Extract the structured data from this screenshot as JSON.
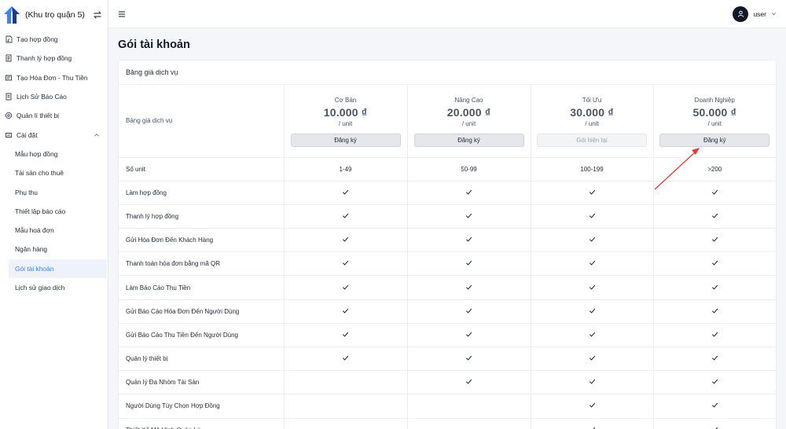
{
  "brand": {
    "name": "(Khu trọ quận 5)"
  },
  "sidebar": {
    "items": [
      {
        "label": "Tạo hợp đồng",
        "icon": "contract-icon"
      },
      {
        "label": "Thanh lý hợp đồng",
        "icon": "document-icon"
      },
      {
        "label": "Tạo Hóa Đơn - Thu Tiền",
        "icon": "invoice-icon"
      },
      {
        "label": "Lịch Sử Báo Cáo",
        "icon": "report-icon"
      },
      {
        "label": "Quản lí thiết bị",
        "icon": "device-icon"
      },
      {
        "label": "Cài đặt",
        "icon": "settings-icon"
      }
    ],
    "sub_items": [
      "Mẫu hợp đồng",
      "Tài sản cho thuê",
      "Phụ thu",
      "Thiết lập báo cáo",
      "Mẫu hoá đơn",
      "Ngân hàng",
      "Gói tài khoản",
      "Lịch sử giao dịch"
    ],
    "active": "Gói tài khoản"
  },
  "topbar": {
    "user_name": "user"
  },
  "page": {
    "title": "Gói tài khoản",
    "card_title": "Bảng giá dịch vụ",
    "header_label": "Bảng giá dịch vụ"
  },
  "plans": [
    {
      "name": "Cơ Bản",
      "price": "10.000 ₫",
      "unit": "/ unit",
      "button": "Đăng ký",
      "current": false
    },
    {
      "name": "Nâng Cao",
      "price": "20.000 ₫",
      "unit": "/ unit",
      "button": "Đăng ký",
      "current": false
    },
    {
      "name": "Tối Ưu",
      "price": "30.000 ₫",
      "unit": "/ unit",
      "button": "Gói hiện tại",
      "current": true
    },
    {
      "name": "Doanh Nghiệp",
      "price": "50.000 ₫",
      "unit": "/ unit",
      "button": "Đăng ký",
      "current": false
    }
  ],
  "units_row": {
    "label": "Số unit",
    "values": [
      "1-49",
      "50-99",
      "100-199",
      ">200"
    ]
  },
  "features": [
    {
      "label": "Làm hợp đồng",
      "included": [
        true,
        true,
        true,
        true
      ]
    },
    {
      "label": "Thanh lý hợp đồng",
      "included": [
        true,
        true,
        true,
        true
      ]
    },
    {
      "label": "Gửi Hóa Đơn Đến Khách Hàng",
      "included": [
        true,
        true,
        true,
        true
      ]
    },
    {
      "label": "Thanh toán hóa đơn bằng mã QR",
      "included": [
        true,
        true,
        true,
        true
      ]
    },
    {
      "label": "Làm Báo Cáo Thu Tiền",
      "included": [
        true,
        true,
        true,
        true
      ]
    },
    {
      "label": "Gửi Báo Cáo Hóa Đơn Đến Người Dùng",
      "included": [
        true,
        true,
        true,
        true
      ]
    },
    {
      "label": "Gửi Báo Cáo Thu Tiền Đến Người Dùng",
      "included": [
        true,
        true,
        true,
        true
      ]
    },
    {
      "label": "Quản lý thiết bị",
      "included": [
        true,
        true,
        true,
        true
      ]
    },
    {
      "label": "Quản lý Đa Nhóm Tài Sản",
      "included": [
        false,
        true,
        true,
        true
      ]
    },
    {
      "label": "Người Dùng Tùy Chọn Hợp Đồng",
      "included": [
        false,
        false,
        true,
        true
      ]
    },
    {
      "label": "Thiết Kế Mô Hình Quản Lý",
      "included": [
        false,
        false,
        true,
        true
      ]
    }
  ],
  "colors": {
    "accent": "#3b82f6",
    "annotation": "#e53935"
  }
}
